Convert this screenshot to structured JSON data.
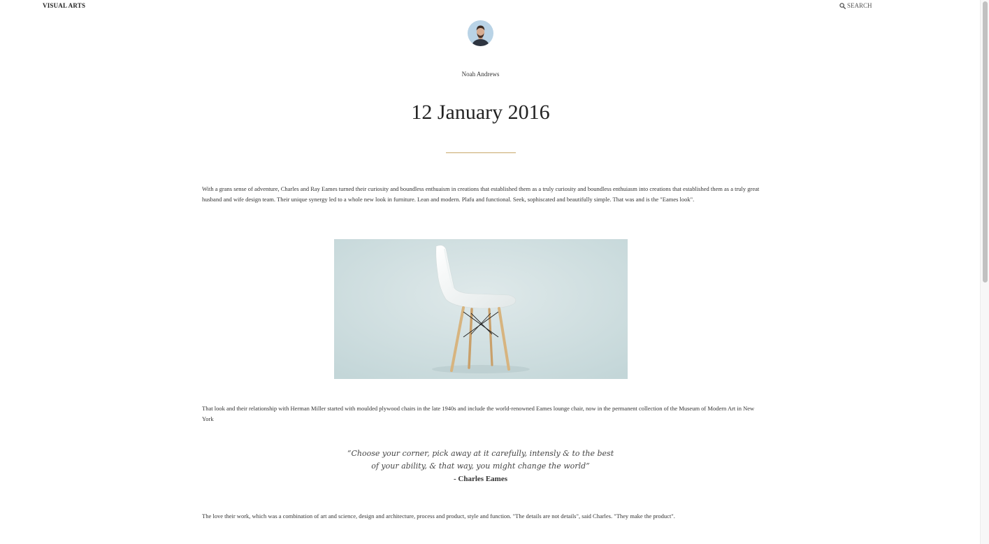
{
  "nav": {
    "brand": "VISUAL ARTS",
    "search_label": "SEARCH",
    "search_icon": "search-icon"
  },
  "author": {
    "name": "Noah Andrews",
    "avatar_icon": "avatar"
  },
  "post": {
    "date": "12 January 2016",
    "accent_color": "#c9a86a",
    "paragraphs": [
      "With a grans sense of adventure, Charles and Ray Eames turned their curiosity and boundless enthuaism in creations that established them as a truly curiosity and boundless enthuiasm into creations that established them as a truly great husband and wife design team. Their unique synergy led to a whole new look in furniture. Lean and modern. Plafu and functional. Seek, sophiscated and beautifully simple. That was and is the \"Eames look\".",
      "That look and their relationship with Herman Miller started with moulded plywood chairs in the late 1940s and include the world-renowned Eames lounge chair, now in the permanent collection of the Museum of Modern Art in New York",
      "The love their work, which was a combination of art and science, design and architecture, process and product, style and function. \"The details are not details\", said Charles. \"They make the product\"."
    ],
    "quote": {
      "line1": "“Choose your corner, pick away at it carefully, intensly & to the best",
      "line2": "of your ability, & that way, you might change the world”",
      "author": "- Charles Eames"
    }
  }
}
